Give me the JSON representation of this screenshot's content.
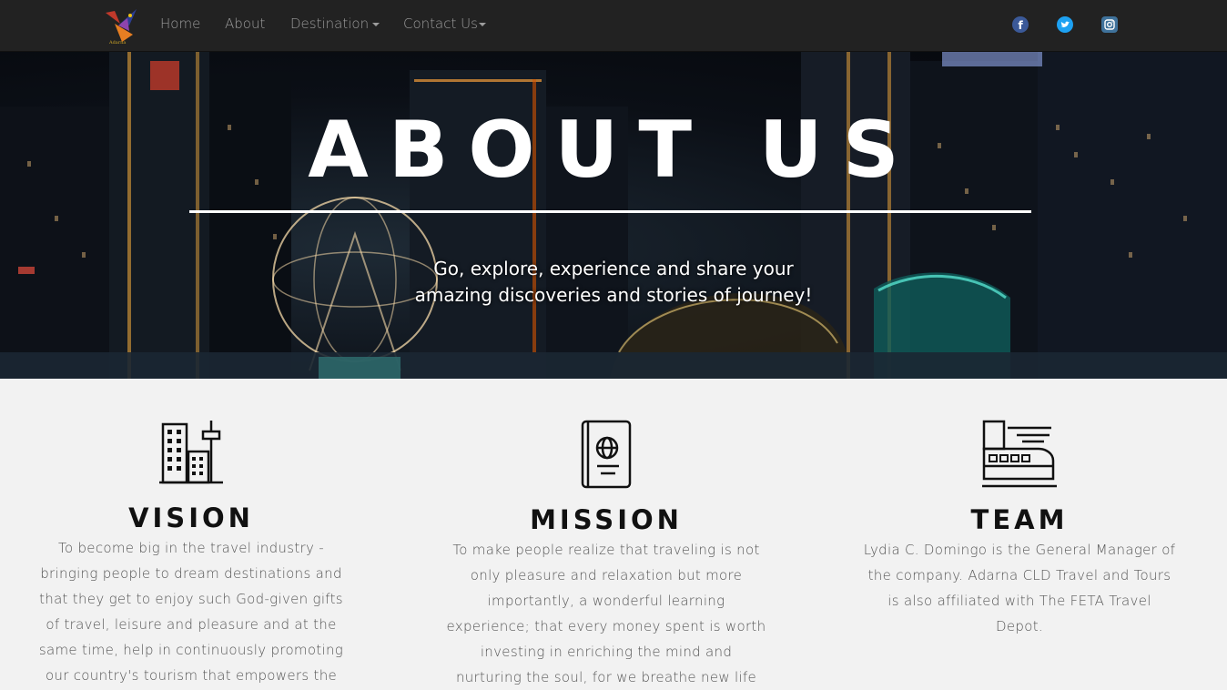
{
  "nav": {
    "logo_alt": "Adarna",
    "items": [
      {
        "label": "Home"
      },
      {
        "label": "About"
      },
      {
        "label": "Destination"
      },
      {
        "label": "Contact Us"
      }
    ],
    "social": [
      "facebook-icon",
      "twitter-icon",
      "instagram-icon"
    ],
    "colors": {
      "bar": "#222222",
      "text": "#9d9d9d",
      "facebook": "#3b5998",
      "twitter": "#1da1f2",
      "instagram": "#3f729b"
    }
  },
  "hero": {
    "title": "ABOUT US",
    "subtitle_line1": "Go, explore, experience and share your",
    "subtitle_line2": "amazing discoveries and stories of journey!"
  },
  "sections": {
    "vision": {
      "icon": "city-buildings-icon",
      "title": "VISION",
      "lines": [
        "To become big in the travel industry -",
        "bringing people to dream destinations and",
        "that they get to enjoy such God-given gifts",
        "of travel, leisure and pleasure and at the",
        "same time, help in continuously promoting",
        "our country's tourism that empowers the"
      ]
    },
    "mission": {
      "icon": "passport-icon",
      "title": "MISSION",
      "lines": [
        "To make people realize that traveling is not",
        "only pleasure and relaxation but more",
        "importantly, a wonderful learning",
        "experience; that every money spent is worth",
        "investing in enriching the mind and",
        "nurturing the soul, for we breathe new life"
      ]
    },
    "team": {
      "icon": "train-icon",
      "title": "TEAM",
      "lines": [
        "Lydia C. Domingo is the General Manager of",
        "the company. Adarna CLD Travel and Tours",
        "is also affiliated with The FETA Travel",
        "Depot."
      ]
    }
  }
}
